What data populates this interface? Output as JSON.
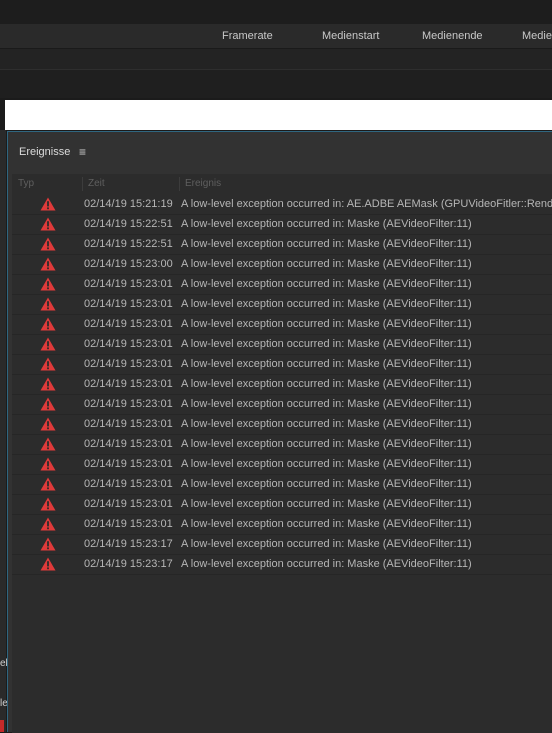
{
  "columns_bar": [
    "Framerate",
    "Medienstart",
    "Medienende",
    "Medie"
  ],
  "panel": {
    "title": "Ereignisse",
    "menu_icon": "≡"
  },
  "table": {
    "headers": [
      "Typ",
      "Zeit",
      "Ereignis"
    ],
    "rows": [
      {
        "type": "error",
        "time": "02/14/19 15:21:19",
        "message": "A low-level exception occurred in: AE.ADBE AEMask (GPUVideoFitler::Rende"
      },
      {
        "type": "error",
        "time": "02/14/19 15:22:51",
        "message": "A low-level exception occurred in: Maske (AEVideoFilter:11)"
      },
      {
        "type": "error",
        "time": "02/14/19 15:22:51",
        "message": "A low-level exception occurred in: Maske (AEVideoFilter:11)"
      },
      {
        "type": "error",
        "time": "02/14/19 15:23:00",
        "message": "A low-level exception occurred in: Maske (AEVideoFilter:11)"
      },
      {
        "type": "error",
        "time": "02/14/19 15:23:01",
        "message": "A low-level exception occurred in: Maske (AEVideoFilter:11)"
      },
      {
        "type": "error",
        "time": "02/14/19 15:23:01",
        "message": "A low-level exception occurred in: Maske (AEVideoFilter:11)"
      },
      {
        "type": "error",
        "time": "02/14/19 15:23:01",
        "message": "A low-level exception occurred in: Maske (AEVideoFilter:11)"
      },
      {
        "type": "error",
        "time": "02/14/19 15:23:01",
        "message": "A low-level exception occurred in: Maske (AEVideoFilter:11)"
      },
      {
        "type": "error",
        "time": "02/14/19 15:23:01",
        "message": "A low-level exception occurred in: Maske (AEVideoFilter:11)"
      },
      {
        "type": "error",
        "time": "02/14/19 15:23:01",
        "message": "A low-level exception occurred in: Maske (AEVideoFilter:11)"
      },
      {
        "type": "error",
        "time": "02/14/19 15:23:01",
        "message": "A low-level exception occurred in: Maske (AEVideoFilter:11)"
      },
      {
        "type": "error",
        "time": "02/14/19 15:23:01",
        "message": "A low-level exception occurred in: Maske (AEVideoFilter:11)"
      },
      {
        "type": "error",
        "time": "02/14/19 15:23:01",
        "message": "A low-level exception occurred in: Maske (AEVideoFilter:11)"
      },
      {
        "type": "error",
        "time": "02/14/19 15:23:01",
        "message": "A low-level exception occurred in: Maske (AEVideoFilter:11)"
      },
      {
        "type": "error",
        "time": "02/14/19 15:23:01",
        "message": "A low-level exception occurred in: Maske (AEVideoFilter:11)"
      },
      {
        "type": "error",
        "time": "02/14/19 15:23:01",
        "message": "A low-level exception occurred in: Maske (AEVideoFilter:11)"
      },
      {
        "type": "error",
        "time": "02/14/19 15:23:01",
        "message": "A low-level exception occurred in: Maske (AEVideoFilter:11)"
      },
      {
        "type": "error",
        "time": "02/14/19 15:23:17",
        "message": "A low-level exception occurred in: Maske (AEVideoFilter:11)"
      },
      {
        "type": "error",
        "time": "02/14/19 15:23:17",
        "message": "A low-level exception occurred in: Maske (AEVideoFilter:11)"
      }
    ]
  },
  "left_edge_fragments": [
    "el",
    "le"
  ],
  "colors": {
    "error_icon": "#e03a3a",
    "panel_border": "#2f6680"
  },
  "icons": {
    "row_type": "warning-triangle-icon",
    "panel_menu": "hamburger-menu-icon"
  }
}
